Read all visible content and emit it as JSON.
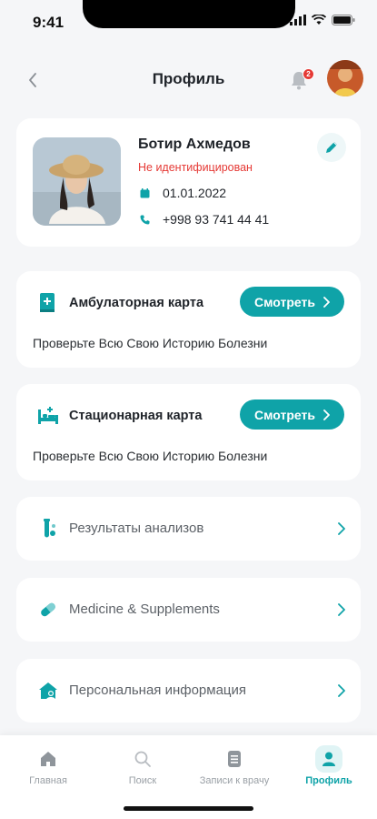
{
  "status_bar": {
    "time": "9:41"
  },
  "header": {
    "title": "Профиль",
    "notification_count": "2"
  },
  "profile": {
    "name": "Ботир Ахмедов",
    "status": "Не идентифицирован",
    "birth_date": "01.01.2022",
    "phone": "+998 93 741 44 41"
  },
  "cards": [
    {
      "title": "Амбулаторная карта",
      "button": "Смотреть",
      "description": "Проверьте Всю Свою Историю Болезни",
      "icon": "document-book-icon"
    },
    {
      "title": "Стационарная карта",
      "button": "Смотреть",
      "description": "Проверьте Всю Свою Историю Болезни",
      "icon": "hospital-bed-icon"
    }
  ],
  "links": [
    {
      "label": "Результаты анализов",
      "icon": "test-tube-icon"
    },
    {
      "label": "Medicine & Supplements",
      "icon": "pill-icon"
    },
    {
      "label": "Персональная информация",
      "icon": "user-home-icon"
    }
  ],
  "tabs": [
    {
      "label": "Главная",
      "icon": "home-icon"
    },
    {
      "label": "Поиск",
      "icon": "search-icon"
    },
    {
      "label": "Записи к врачу",
      "icon": "clipboard-icon"
    },
    {
      "label": "Профиль",
      "icon": "profile-icon",
      "active": true
    }
  ],
  "colors": {
    "accent": "#0fa3a8",
    "danger": "#e53935",
    "background": "#f5f6f8"
  }
}
